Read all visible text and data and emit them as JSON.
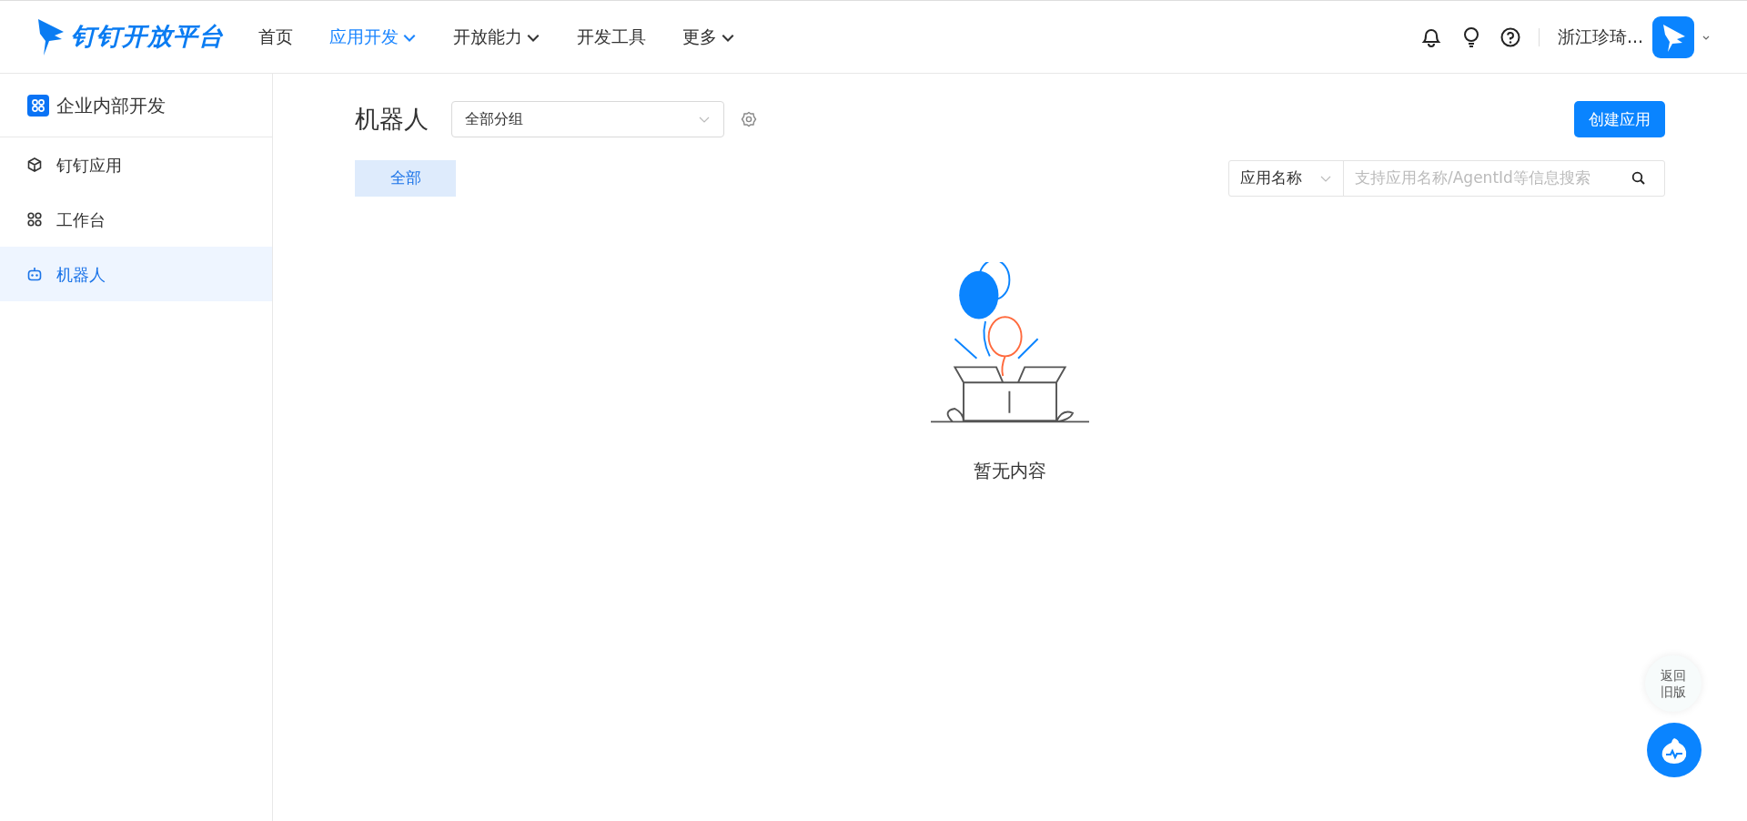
{
  "header": {
    "logo": "钉钉开放平台",
    "nav": [
      {
        "label": "首页",
        "selected": false,
        "dropdown": false
      },
      {
        "label": "应用开发",
        "selected": true,
        "dropdown": true
      },
      {
        "label": "开放能力",
        "selected": false,
        "dropdown": true
      },
      {
        "label": "开发工具",
        "selected": false,
        "dropdown": false
      },
      {
        "label": "更多",
        "selected": false,
        "dropdown": true
      }
    ],
    "org_name": "浙江珍琦..."
  },
  "sidebar": {
    "title": "企业内部开发",
    "items": [
      {
        "label": "钉钉应用",
        "kind": "cube",
        "selected": false
      },
      {
        "label": "工作台",
        "kind": "grid",
        "selected": false
      },
      {
        "label": "机器人",
        "kind": "robot",
        "selected": true
      }
    ]
  },
  "main": {
    "title": "机器人",
    "group_select": {
      "value": "全部分组"
    },
    "create_button": "创建应用",
    "tabs": [
      {
        "label": "全部",
        "selected": true
      }
    ],
    "search": {
      "field_select": "应用名称",
      "placeholder": "支持应用名称/AgentId等信息搜索"
    },
    "empty_text": "暂无内容"
  },
  "float": {
    "old_version": "返回旧版"
  }
}
